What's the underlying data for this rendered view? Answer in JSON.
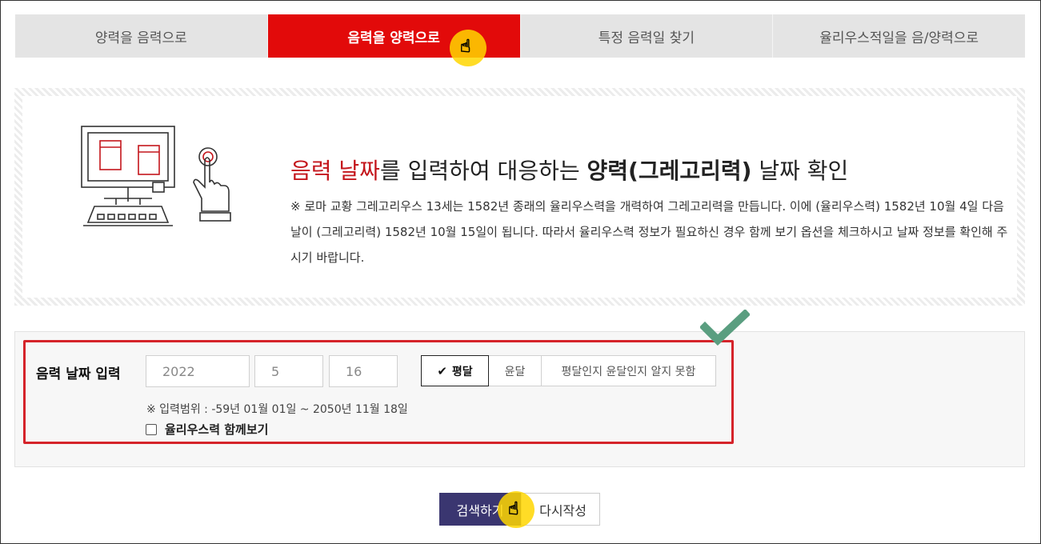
{
  "tabs": [
    {
      "label": "양력을 음력으로"
    },
    {
      "label": "음력을 양력으로",
      "active": true
    },
    {
      "label": "특정 음력일 찾기"
    },
    {
      "label": "율리우스적일을 음/양력으로"
    }
  ],
  "info": {
    "title_red": "음력 날짜",
    "title_mid": "를 입력하여 대응하는 ",
    "title_bold": "양력(그레고리력)",
    "title_end": " 날짜 확인",
    "description": "※ 로마 교황 그레고리우스 13세는 1582년 종래의 율리우스력을 개력하여 그레고리력을 만듭니다. 이에 (율리우스력) 1582년 10월 4일 다음 날이 (그레고리력) 1582년 10월 15일이 됩니다. 따라서 율리우스력 정보가 필요하신 경우 함께 보기 옵션을 체크하시고 날짜 정보를 확인해 주시기 바랍니다."
  },
  "form": {
    "label": "음력 날짜 입력",
    "year": "2022",
    "month": "5",
    "day": "16",
    "moon_options": [
      {
        "label": "평달",
        "selected": true
      },
      {
        "label": "윤달"
      },
      {
        "label": "평달인지 윤달인지 알지 못함"
      }
    ],
    "range_note": "※ 입력범위 : -59년 01월 01일 ~ 2050년 11월 18일",
    "julian_checkbox_label": "율리우스력 함께보기"
  },
  "buttons": {
    "search": "검색하기",
    "reset": "다시작성"
  },
  "colors": {
    "active_tab": "#e20a0a",
    "highlight_frame": "#d5232a",
    "search_button": "#3a3670",
    "check_mark": "#5a9e80",
    "cursor_highlight": "#ffd600"
  },
  "icons": [
    "hand-pointer-icon",
    "check-icon",
    "computer-illustration",
    "touch-hand-icon"
  ]
}
